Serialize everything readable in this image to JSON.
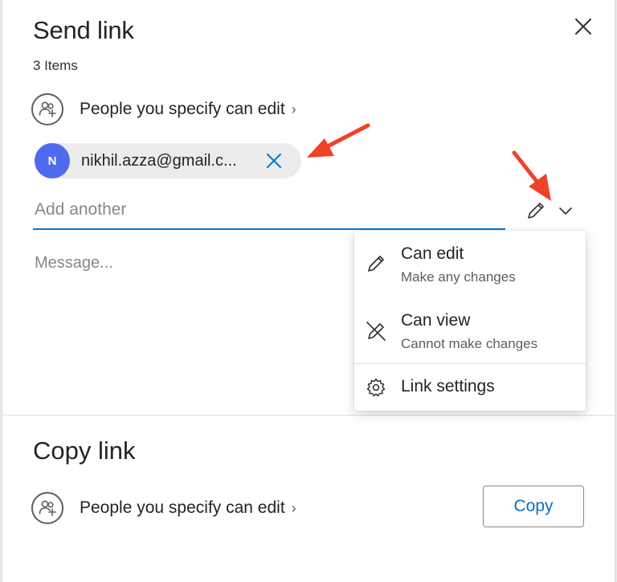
{
  "send_link": {
    "title": "Send link",
    "items_count": "3 Items",
    "permission_text": "People you specify can edit",
    "permission_chevron": "›",
    "recipient": {
      "initial": "N",
      "email": "nikhil.azza@gmail.c...",
      "avatar_color": "#4f6bed"
    },
    "add_placeholder": "Add another",
    "message_placeholder": "Message..."
  },
  "permission_menu": {
    "items": [
      {
        "label": "Can edit",
        "description": "Make any changes",
        "icon": "pencil-icon"
      },
      {
        "label": "Can view",
        "description": "Cannot make changes",
        "icon": "pencil-slash-icon"
      },
      {
        "label": "Link settings",
        "icon": "gear-icon"
      }
    ]
  },
  "copy_link": {
    "title": "Copy link",
    "permission_text": "People you specify can edit",
    "permission_chevron": "›",
    "copy_button": "Copy"
  },
  "colors": {
    "accent": "#0078d4",
    "annotation_arrow": "#f0412a"
  }
}
